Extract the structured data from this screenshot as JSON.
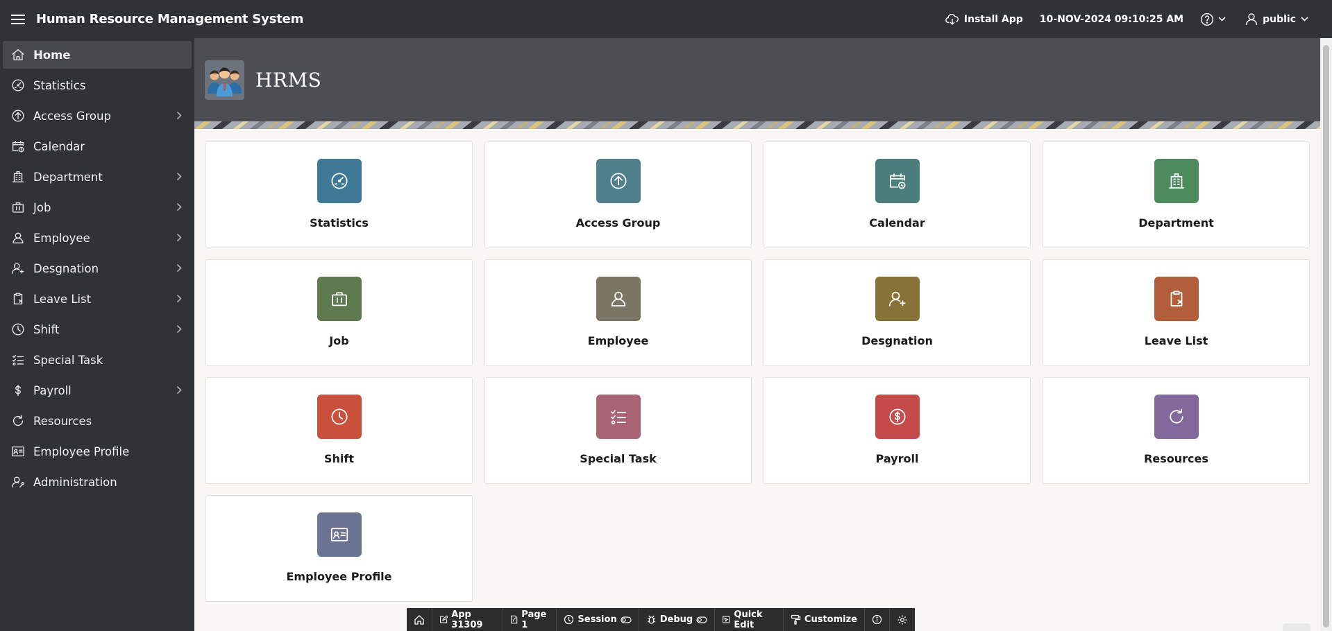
{
  "header": {
    "app_title": "Human Resource Management System",
    "install_label": "Install App",
    "datetime": "10-NOV-2024 09:10:25 AM",
    "user": "public"
  },
  "sidebar": {
    "items": [
      {
        "label": "Home",
        "icon": "home-icon",
        "active": true,
        "has_children": false
      },
      {
        "label": "Statistics",
        "icon": "gauge-icon",
        "has_children": false
      },
      {
        "label": "Access Group",
        "icon": "arrow-up-circle-icon",
        "has_children": true
      },
      {
        "label": "Calendar",
        "icon": "calendar-clock-icon",
        "has_children": false
      },
      {
        "label": "Department",
        "icon": "building-icon",
        "has_children": true
      },
      {
        "label": "Job",
        "icon": "briefcase-icon",
        "has_children": true
      },
      {
        "label": "Employee",
        "icon": "user-icon",
        "has_children": true
      },
      {
        "label": "Desgnation",
        "icon": "user-plus-icon",
        "has_children": true
      },
      {
        "label": "Leave List",
        "icon": "clipboard-x-icon",
        "has_children": true
      },
      {
        "label": "Shift",
        "icon": "clock-icon",
        "has_children": true
      },
      {
        "label": "Special Task",
        "icon": "checklist-icon",
        "has_children": false
      },
      {
        "label": "Payroll",
        "icon": "dollar-icon",
        "has_children": true
      },
      {
        "label": "Resources",
        "icon": "refresh-icon",
        "has_children": false
      },
      {
        "label": "Employee Profile",
        "icon": "id-card-icon",
        "has_children": false
      },
      {
        "label": "Administration",
        "icon": "user-wrench-icon",
        "has_children": false
      }
    ]
  },
  "hero": {
    "title": "HRMS"
  },
  "cards": [
    {
      "label": "Statistics",
      "icon": "gauge-icon",
      "color": "#3e7a96"
    },
    {
      "label": "Access Group",
      "icon": "arrow-up-circle-icon",
      "color": "#4f7f8a"
    },
    {
      "label": "Calendar",
      "icon": "calendar-clock-icon",
      "color": "#4b7e7b"
    },
    {
      "label": "Department",
      "icon": "building-icon",
      "color": "#4d8a5e"
    },
    {
      "label": "Job",
      "icon": "briefcase-icon",
      "color": "#5d7b4e"
    },
    {
      "label": "Employee",
      "icon": "user-icon",
      "color": "#7b7664"
    },
    {
      "label": "Desgnation",
      "icon": "user-plus-icon",
      "color": "#877238"
    },
    {
      "label": "Leave List",
      "icon": "clipboard-x-icon",
      "color": "#b25e3a"
    },
    {
      "label": "Shift",
      "icon": "clock-icon",
      "color": "#c9503c"
    },
    {
      "label": "Special Task",
      "icon": "checklist-icon",
      "color": "#a86576"
    },
    {
      "label": "Payroll",
      "icon": "dollar-icon",
      "color": "#c54a4a"
    },
    {
      "label": "Resources",
      "icon": "refresh-icon",
      "color": "#83689b"
    },
    {
      "label": "Employee Profile",
      "icon": "id-card-icon",
      "color": "#6c7493"
    }
  ],
  "devbar": {
    "app": "App 31309",
    "page": "Page 1",
    "session": "Session",
    "debug": "Debug",
    "quick_edit": "Quick Edit",
    "customize": "Customize"
  }
}
